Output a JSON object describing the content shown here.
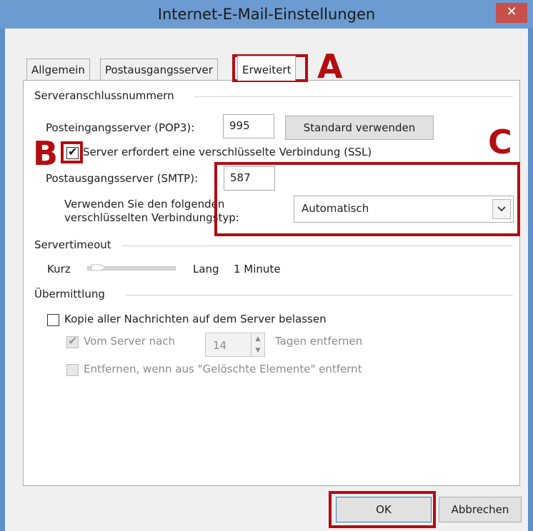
{
  "window": {
    "title": "Internet-E-Mail-Einstellungen",
    "close_label": "✕"
  },
  "tabs": [
    {
      "label": "Allgemein"
    },
    {
      "label": "Postausgangsserver"
    },
    {
      "label": "Erweitert",
      "active": true
    }
  ],
  "annotations": {
    "a": "A",
    "b": "B",
    "c": "C"
  },
  "server_ports": {
    "group_label": "Serveranschlussnummern",
    "pop3_label": "Posteingangsserver (POP3):",
    "pop3_value": "995",
    "default_button": "Standard verwenden",
    "ssl_label": "Server erfordert eine verschlüsselte Verbindung (SSL)",
    "ssl_checked": true,
    "smtp_label": "Postausgangsserver (SMTP):",
    "smtp_value": "587",
    "conn_type_label_1": "Verwenden Sie den folgenden",
    "conn_type_label_2": "verschlüsselten Verbindungstyp:",
    "conn_type_value": "Automatisch"
  },
  "timeout": {
    "group_label": "Servertimeout",
    "short_label": "Kurz",
    "long_label": "Lang",
    "value_label": "1 Minute",
    "level": 0.05
  },
  "delivery": {
    "group_label": "Übermittlung",
    "keep_copy_label": "Kopie aller Nachrichten auf dem Server belassen",
    "keep_copy_checked": false,
    "remove_after_label": "Vom Server nach",
    "remove_after_checked": true,
    "remove_after_days": "14",
    "days_label": "Tagen entfernen",
    "remove_deleted_label": "Entfernen, wenn aus \"Gelöschte Elemente\" entfernt",
    "remove_deleted_checked": false
  },
  "footer": {
    "ok_label": "OK",
    "cancel_label": "Abbrechen"
  },
  "colors": {
    "annotation_red": "#b30d12",
    "titlebar": "#6b9bd1",
    "close": "#c7504a"
  }
}
